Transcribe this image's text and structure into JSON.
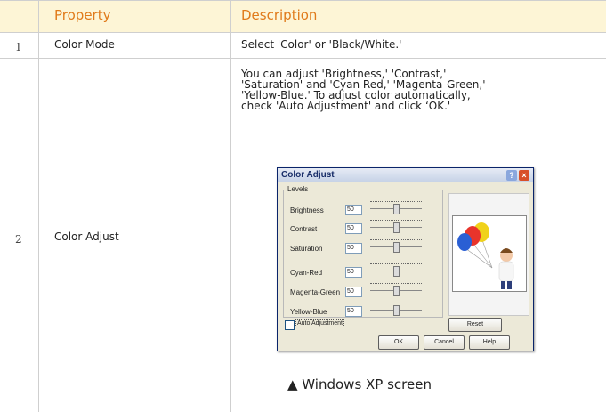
{
  "table": {
    "headers": {
      "property": "Property",
      "description": "Description"
    },
    "rows": [
      {
        "num": "1",
        "property": "Color Mode",
        "description": "Select 'Color' or 'Black/White.'"
      },
      {
        "num": "2",
        "property": "Color Adjust",
        "description_lines": [
          "You can adjust 'Brightness,' 'Contrast,'",
          "'Saturation' and 'Cyan Red,' 'Magenta-Green,'",
          "'Yellow-Blue.' To adjust color automatically,",
          "check 'Auto Adjustment' and click ‘OK.'"
        ]
      }
    ],
    "header_color": "#e07a1a",
    "header_bg": "#fdf5d6"
  },
  "dialog": {
    "title": "Color Adjust",
    "help_glyph": "?",
    "close_glyph": "×",
    "group_label": "Levels",
    "rows": [
      {
        "label": "Brightness",
        "value": "50"
      },
      {
        "label": "Contrast",
        "value": "50"
      },
      {
        "label": "Saturation",
        "value": "50"
      },
      {
        "label": "Cyan-Red",
        "value": "50"
      },
      {
        "label": "Magenta-Green",
        "value": "50"
      },
      {
        "label": "Yellow-Blue",
        "value": "50"
      }
    ],
    "auto_adjustment_label": "Auto Adjustment",
    "auto_adjustment_checked": false,
    "reset_label": "Reset",
    "ok_label": "OK",
    "cancel_label": "Cancel",
    "help_label": "Help"
  },
  "caption": "▲ Windows XP screen"
}
